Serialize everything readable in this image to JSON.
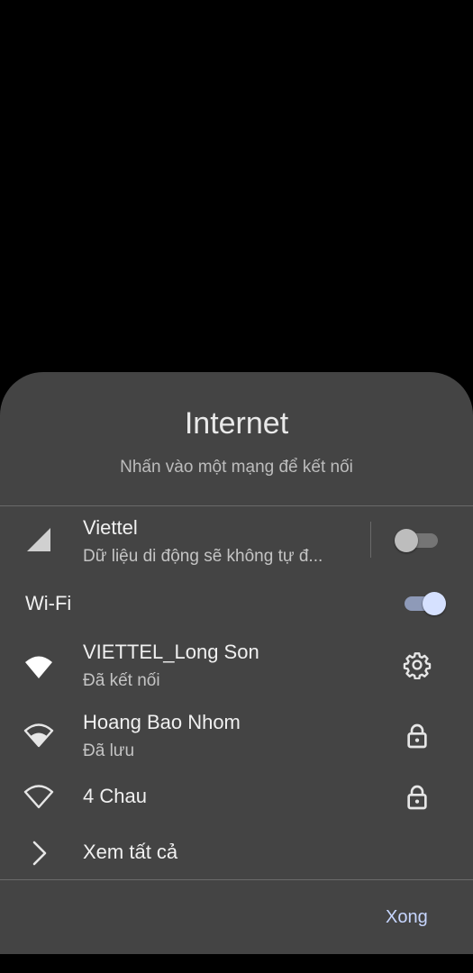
{
  "panel": {
    "title": "Internet",
    "subtitle": "Nhấn vào một mạng để kết nối"
  },
  "mobile": {
    "name": "Viettel",
    "status": "Dữ liệu di động sẽ không tự đ...",
    "toggle_on": false,
    "icon": "cellular-signal-icon"
  },
  "wifi": {
    "label": "Wi-Fi",
    "toggle_on": true,
    "networks": [
      {
        "name": "VIETTEL_Long Son",
        "status": "Đã kết nối",
        "icon": "wifi-connected-icon",
        "action_icon": "gear-icon"
      },
      {
        "name": "Hoang Bao Nhom",
        "status": "Đã lưu",
        "icon": "wifi-icon",
        "action_icon": "lock-icon"
      },
      {
        "name": "4 Chau",
        "status": "",
        "icon": "wifi-outline-icon",
        "action_icon": "lock-icon"
      }
    ],
    "see_all": "Xem tất cả"
  },
  "footer": {
    "done_label": "Xong"
  },
  "colors": {
    "sheet_bg": "#444444",
    "accent": "#c7d6ff",
    "toggle_on_thumb": "#d6e1ff"
  }
}
